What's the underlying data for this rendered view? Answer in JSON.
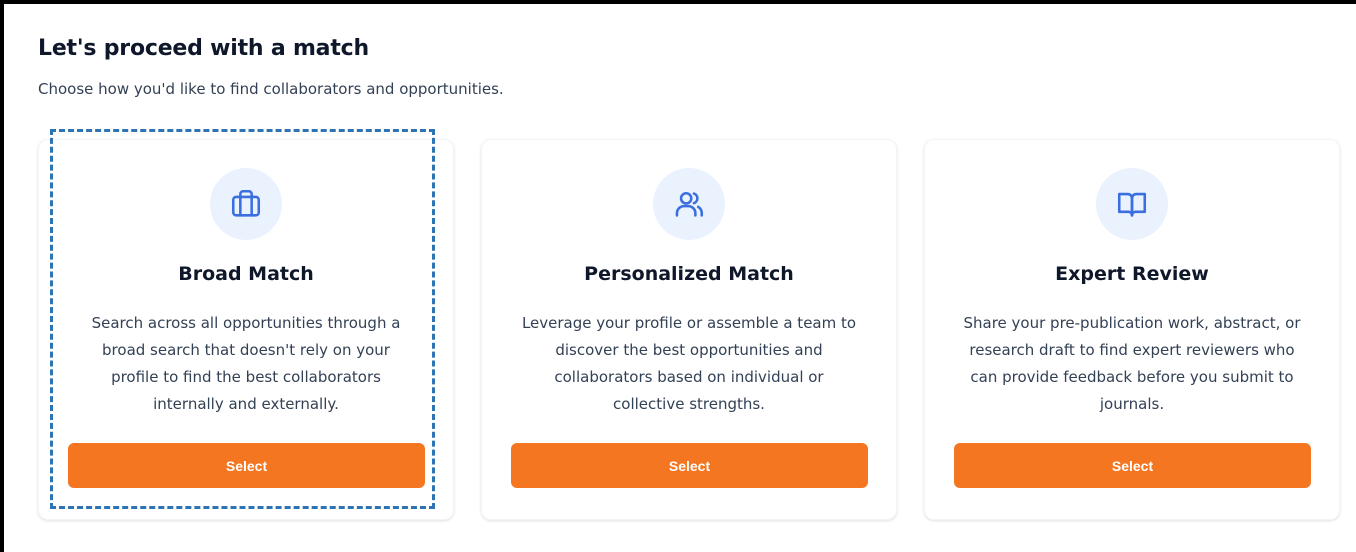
{
  "header": {
    "title": "Let's proceed with a match",
    "subtitle": "Choose how you'd like to find collaborators and opportunities."
  },
  "colors": {
    "accent": "#f47621",
    "icon": "#3b6fe0",
    "icon_bg": "#eaf2fe",
    "highlight": "#2e74b5"
  },
  "cards": [
    {
      "icon": "briefcase-icon",
      "title": "Broad Match",
      "description": "Search across all opportunities through a broad search that doesn't rely on your profile to find the best collaborators internally and externally.",
      "button": "Select",
      "selected": true
    },
    {
      "icon": "users-icon",
      "title": "Personalized Match",
      "description": "Leverage your profile or assemble a team to discover the best opportunities and collaborators based on individual or collective strengths.",
      "button": "Select",
      "selected": false
    },
    {
      "icon": "book-open-icon",
      "title": "Expert Review",
      "description": "Share your pre-publication work, abstract, or research draft to find expert reviewers who can provide feedback before you submit to journals.",
      "button": "Select",
      "selected": false
    }
  ]
}
